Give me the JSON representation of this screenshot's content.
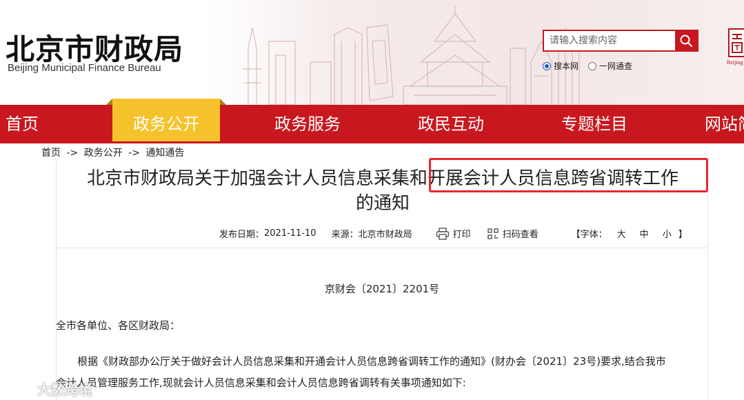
{
  "site": {
    "name_cn": "北京市财政局",
    "name_en": "Beijing Municipal Finance Bureau",
    "seal_caption": "Beijing"
  },
  "search": {
    "placeholder": "请输入搜索内容",
    "scope_options": [
      "搜本网",
      "一网通查"
    ],
    "scope_selected": "搜本网"
  },
  "nav": {
    "items": [
      "首页",
      "政务公开",
      "政务服务",
      "政民互动",
      "专题栏目",
      "网站简"
    ],
    "active": "政务公开"
  },
  "breadcrumb": {
    "items": [
      "首页",
      "政务公开",
      "通知通告"
    ],
    "separator": "->"
  },
  "article": {
    "title_line1": "北京市财政局关于加强会计人员信息采集和开展会计人员信息跨省调转工作",
    "title_line2": "的通知",
    "publish_label": "发布日期：",
    "publish_date": "2021-11-10",
    "source_label": "来源：",
    "source": "北京市财政局",
    "print_label": "打印",
    "qr_label": "扫码查看",
    "font_label": "【字体：",
    "font_sizes": [
      "大",
      "中",
      "小"
    ],
    "font_end": "】",
    "doc_number": "京财会〔2021〕2201号",
    "salutation": "全市各单位、各区财政局：",
    "body_line1": "根据《财政部办公厅关于做好会计人员信息采集和开通会计人员信息跨省调转工作的通知》(财办会〔2021〕23号)要求,结合我市",
    "body_line2": "会计人员管理服务工作,现就会计人员信息采集和会计人员信息跨省调转有关事项通知如下:"
  },
  "watermark": {
    "text": "大数跨境"
  },
  "colors": {
    "brand_red": "#c8171e",
    "nav_active": "#f6c22b",
    "highlight": "#e8262e"
  }
}
